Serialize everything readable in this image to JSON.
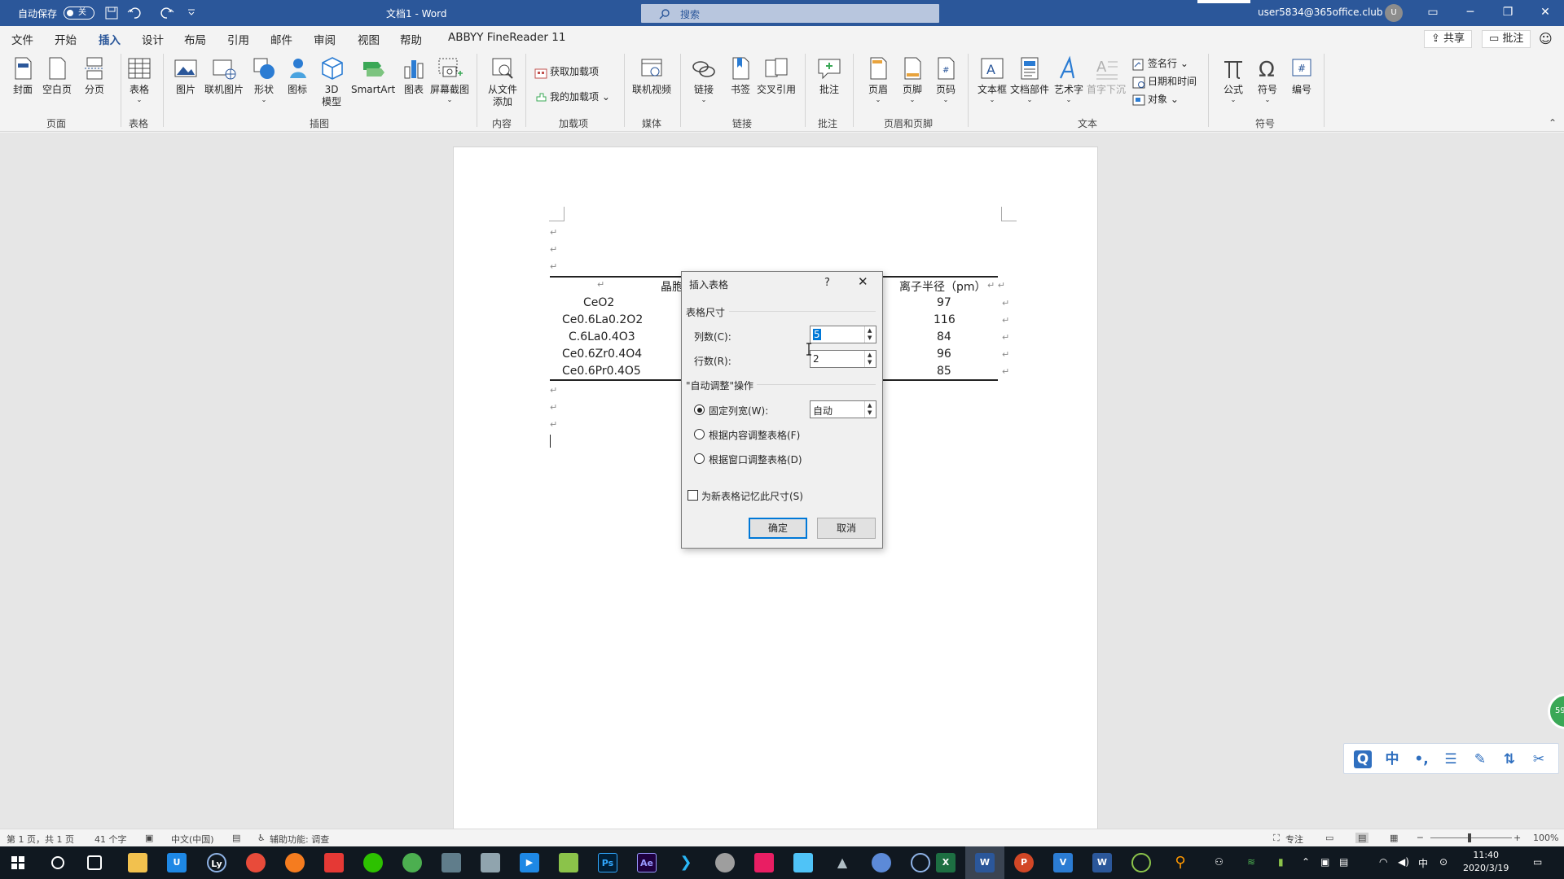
{
  "titlebar": {
    "autosave_label": "自动保存",
    "autosave_state": "关",
    "doc_title": "文档1  -  Word",
    "search_placeholder": "搜索",
    "user": "user5834@365office.club",
    "avatar_initial": "U"
  },
  "tabs": [
    "文件",
    "开始",
    "插入",
    "设计",
    "布局",
    "引用",
    "邮件",
    "审阅",
    "视图",
    "帮助",
    "ABBYY FineReader 11"
  ],
  "active_tab": "插入",
  "share_label": "共享",
  "comment_label": "批注",
  "ribbon": {
    "page": [
      "封面",
      "空白页",
      "分页"
    ],
    "table": "表格",
    "illustrations": [
      "图片",
      "联机图片",
      "形状",
      "图标",
      "3D 模型",
      "SmartArt",
      "图表",
      "屏幕截图"
    ],
    "content": "从文件 添加",
    "addins": [
      "获取加载项",
      "我的加载项"
    ],
    "media": "联机视频",
    "links": [
      "链接",
      "书签",
      "交叉引用"
    ],
    "comment": "批注",
    "header_footer": [
      "页眉",
      "页脚",
      "页码"
    ],
    "text": [
      "文本框",
      "文档部件",
      "艺术字",
      "首字下沉"
    ],
    "text_small": [
      "签名行",
      "日期和时间",
      "对象"
    ],
    "symbols": [
      "公式",
      "符号",
      "编号"
    ],
    "groups": [
      "页面",
      "表格",
      "插图",
      "内容",
      "加载项",
      "媒体",
      "链接",
      "批注",
      "页眉和页脚",
      "文本",
      "符号"
    ]
  },
  "document": {
    "header_left": "晶胞",
    "header_right": "离子半径（pm）",
    "rows": [
      {
        "name": "CeO2",
        "radius": "97"
      },
      {
        "name": "Ce0.6La0.2O2",
        "radius": "116"
      },
      {
        "name": "C.6La0.4O3",
        "radius": "84"
      },
      {
        "name": "Ce0.6Zr0.4O4",
        "radius": "96"
      },
      {
        "name": "Ce0.6Pr0.4O5",
        "radius": "85"
      }
    ]
  },
  "dialog": {
    "title": "插入表格",
    "help": "?",
    "section_size": "表格尺寸",
    "columns_label": "列数(C):",
    "columns_value": "5",
    "rows_label": "行数(R):",
    "rows_value": "2",
    "section_autofit": "\"自动调整\"操作",
    "fixed_width_label": "固定列宽(W):",
    "fixed_width_value": "自动",
    "autofit_content_label": "根据内容调整表格(F)",
    "autofit_window_label": "根据窗口调整表格(D)",
    "remember_label": "为新表格记忆此尺寸(S)",
    "ok": "确定",
    "cancel": "取消"
  },
  "statusbar": {
    "page": "第 1 页，共 1 页",
    "words": "41 个字",
    "language": "中文(中国)",
    "accessibility": "辅助功能: 调查",
    "focus": "专注",
    "zoom": "100%"
  },
  "floating": {
    "badge": "59",
    "buttons": [
      "Q",
      "中",
      "•,",
      "☰",
      "✎",
      "⇅",
      "✂"
    ]
  },
  "taskbar": {
    "time": "11:40",
    "date": "2020/3/19",
    "ime": "中"
  },
  "colors": {
    "word_blue": "#2b579a",
    "accent": "#0078d7"
  }
}
